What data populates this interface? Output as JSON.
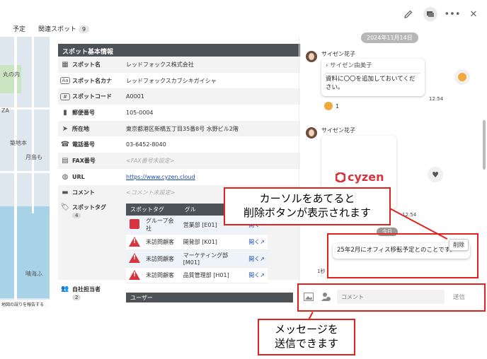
{
  "header": {
    "tabs": [
      {
        "label": "予定"
      },
      {
        "label": "関連スポット",
        "count": "9"
      }
    ]
  },
  "map": {
    "labels": [
      "丸の内",
      "ZA",
      "築地本",
      "月島も",
      "晴海ふ"
    ],
    "footer": "地図の誤りを報告する"
  },
  "spot": {
    "section_title": "スポット基本情報",
    "rows": [
      {
        "icon": "building-icon",
        "label": "スポット名",
        "value": "レッドフォックス株式会社",
        "kind": "text"
      },
      {
        "icon": "kana-icon",
        "label": "スポット名カナ",
        "value": "レッドフォックスカブシキガイシャ",
        "kind": "text"
      },
      {
        "icon": "hash-icon",
        "label": "スポットコード",
        "value": "A0001",
        "kind": "text"
      },
      {
        "icon": "postbox-icon",
        "label": "郵便番号",
        "value": "105-0004",
        "kind": "text"
      },
      {
        "icon": "location-arrow-icon",
        "label": "所在地",
        "value": "東京都港区新橋五丁目35番8号 水野ビル2階",
        "kind": "text"
      },
      {
        "icon": "phone-icon",
        "label": "電話番号",
        "value": "03-6452-8040",
        "kind": "text"
      },
      {
        "icon": "fax-icon",
        "label": "FAX番号",
        "value": "<FAX番号未設定>",
        "kind": "placeholder"
      },
      {
        "icon": "globe-icon",
        "label": "URL",
        "value": "https://www.cyzen.cloud",
        "kind": "link"
      },
      {
        "icon": "comment-icon",
        "label": "コメント",
        "value": "<コメント未設定>",
        "kind": "placeholder"
      }
    ],
    "tags": {
      "label": "スポットタグ",
      "count": "4",
      "columns": [
        "スポットタグ",
        "グル"
      ],
      "items": [
        {
          "icon": "stack-icon",
          "name": "グループ会社",
          "group": "営業部 [E01]",
          "action": "開く"
        },
        {
          "icon": "warning-icon",
          "name": "未訪問顧客",
          "group": "開発部 [K01]",
          "action": "開く↗"
        },
        {
          "icon": "warning-icon",
          "name": "未訪問顧客",
          "group": "マーケティング部 [M01]",
          "action": "開く↗"
        },
        {
          "icon": "warning-icon",
          "name": "未訪問顧客",
          "group": "品質管理部 [H01]",
          "action": "開く↗"
        }
      ]
    },
    "owner": {
      "label": "自社担当者",
      "count": "2",
      "column": "ユーザー"
    }
  },
  "chat": {
    "date": "2024年11月14日",
    "messages": [
      {
        "sender": "サイゼン花子",
        "quote": "サイゼン由美子",
        "text": "資料に〇〇を追加しておいてください。",
        "time": "12:54",
        "reaction_count": "1"
      },
      {
        "sender": "サイゼン花子",
        "image_logo": "cyzen",
        "time": "12:54"
      }
    ],
    "today_label": "今日",
    "own_message": "25年2月にオフィス移転予定とのことです。",
    "own_time": "1秒",
    "delete_label": "削除",
    "input": {
      "placeholder": "コメント",
      "send_label": "送信"
    }
  },
  "callouts": {
    "delete_hint": "カーソルをあてると\n削除ボタンが表示されます",
    "send_hint": "メッセージを\n送信できます"
  },
  "colors": {
    "accent_red": "#e0241d",
    "header_dark": "#4d5257",
    "link_blue": "#1a4fb5",
    "brand_red": "#d8343f"
  }
}
